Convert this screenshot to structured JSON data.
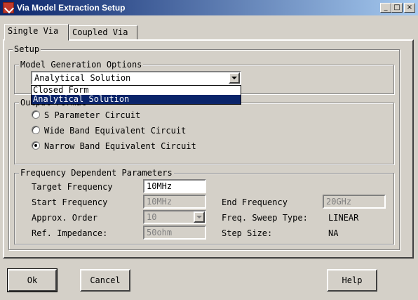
{
  "window": {
    "title": "Via Model Extraction Setup",
    "caption_buttons": {
      "minimize": "_",
      "maximize": "□",
      "close": "×"
    }
  },
  "tabs": [
    {
      "label": "Single Via",
      "active": true
    },
    {
      "label": "Coupled Via",
      "active": false
    }
  ],
  "setup": {
    "legend": "Setup",
    "model_generation": {
      "legend": "Model Generation Options",
      "selected": "Analytical Solution",
      "options": [
        "Closed Form",
        "Analytical Solution"
      ],
      "highlighted_option": "Analytical Solution"
    },
    "output_format": {
      "legend": "Output Format",
      "options": [
        "S Parameter Circuit",
        "Wide Band Equivalent Circuit",
        "Narrow Band Equivalent Circuit"
      ],
      "selected_index": 2
    },
    "frequency": {
      "legend": "Frequency Dependent Parameters",
      "target_frequency": {
        "label": "Target Frequency",
        "value": "10MHz"
      },
      "start_frequency": {
        "label": "Start Frequency",
        "value": "10MHz"
      },
      "end_frequency": {
        "label": "End Frequency",
        "value": "20GHz"
      },
      "approx_order": {
        "label": "Approx. Order",
        "value": "10"
      },
      "sweep_type": {
        "label": "Freq. Sweep Type:",
        "value": "LINEAR"
      },
      "ref_impedance": {
        "label": "Ref. Impedance:",
        "value": "50ohm"
      },
      "step_size": {
        "label": "Step Size:",
        "value": "NA"
      }
    }
  },
  "buttons": {
    "ok": "Ok",
    "cancel": "Cancel",
    "help": "Help"
  },
  "colors": {
    "titlebar_start": "#0a246a",
    "titlebar_end": "#a6caf0",
    "face": "#d4d0c8",
    "selection": "#0a246a"
  }
}
